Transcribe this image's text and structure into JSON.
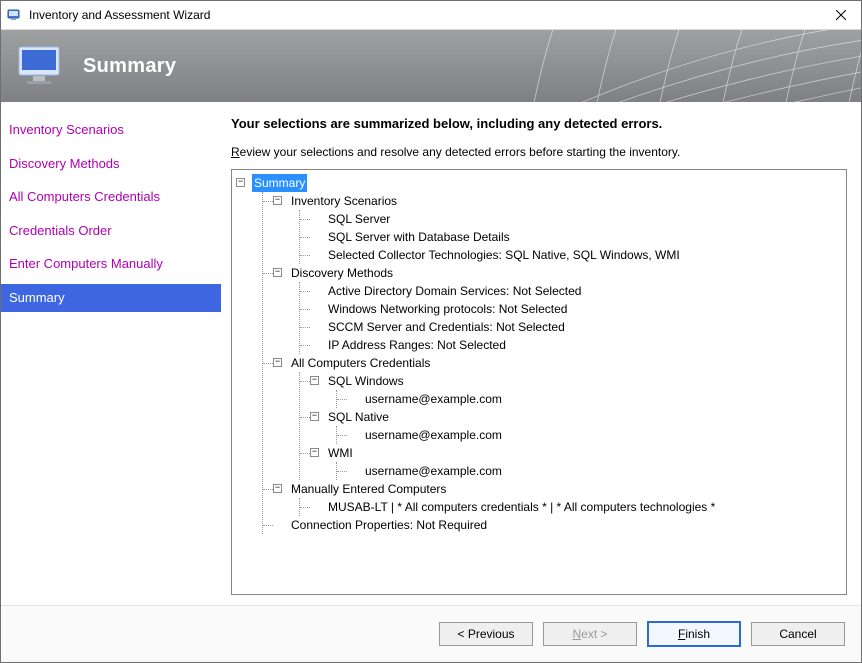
{
  "window": {
    "title": "Inventory and Assessment Wizard"
  },
  "banner": {
    "title": "Summary"
  },
  "sidebar": {
    "items": [
      {
        "label": "Inventory Scenarios",
        "state": "visited"
      },
      {
        "label": "Discovery Methods",
        "state": "visited"
      },
      {
        "label": "All Computers Credentials",
        "state": "visited"
      },
      {
        "label": "Credentials Order",
        "state": "visited"
      },
      {
        "label": "Enter Computers Manually",
        "state": "visited"
      },
      {
        "label": "Summary",
        "state": "current"
      }
    ]
  },
  "main": {
    "heading": "Your selections are summarized below, including any detected errors.",
    "instruction_prefix": "R",
    "instruction_rest": "eview your selections and resolve any detected errors before starting the inventory."
  },
  "tree": {
    "root": {
      "label": "Summary",
      "selected": true,
      "children": [
        {
          "label": "Inventory Scenarios",
          "children": [
            {
              "label": "SQL Server"
            },
            {
              "label": "SQL Server with Database Details"
            },
            {
              "label": "Selected Collector Technologies: SQL Native, SQL Windows, WMI"
            }
          ]
        },
        {
          "label": "Discovery Methods",
          "children": [
            {
              "label": "Active Directory Domain Services: Not Selected"
            },
            {
              "label": "Windows Networking protocols: Not Selected"
            },
            {
              "label": "SCCM Server and Credentials: Not Selected"
            },
            {
              "label": "IP Address Ranges: Not Selected"
            }
          ]
        },
        {
          "label": "All Computers Credentials",
          "children": [
            {
              "label": "SQL Windows",
              "children": [
                {
                  "label": "username@example.com"
                }
              ]
            },
            {
              "label": "SQL Native",
              "children": [
                {
                  "label": "username@example.com"
                }
              ]
            },
            {
              "label": "WMI",
              "children": [
                {
                  "label": "username@example.com"
                }
              ]
            }
          ]
        },
        {
          "label": "Manually Entered Computers",
          "children": [
            {
              "label": "MUSAB-LT | * All computers credentials * | * All computers technologies *"
            }
          ]
        },
        {
          "label": "Connection Properties: Not Required"
        }
      ]
    }
  },
  "buttons": {
    "previous": "< Previous",
    "next_prefix": "N",
    "next_rest": "ext >",
    "finish_prefix": "F",
    "finish_rest": "inish",
    "cancel": "Cancel"
  }
}
